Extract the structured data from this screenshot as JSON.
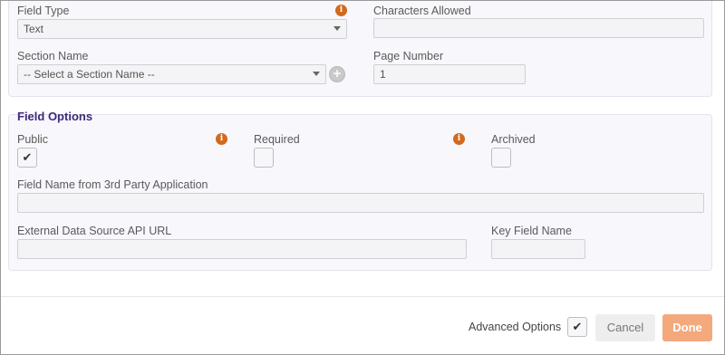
{
  "top_section": {
    "field_type": {
      "label": "Field Type",
      "value": "Text",
      "info_icon": "info-icon"
    },
    "characters_allowed": {
      "label": "Characters Allowed",
      "value": ""
    },
    "section_name": {
      "label": "Section Name",
      "value": "-- Select a Section Name --",
      "add_icon": "plus-icon"
    },
    "page_number": {
      "label": "Page Number",
      "value": "1"
    }
  },
  "field_options": {
    "title": "Field Options",
    "public": {
      "label": "Public",
      "checked": true,
      "check_glyph": "✔",
      "info_icon": "info-icon"
    },
    "required": {
      "label": "Required",
      "checked": false,
      "info_icon": "info-icon"
    },
    "archived": {
      "label": "Archived",
      "checked": false
    },
    "third_party_name": {
      "label": "Field Name from 3rd Party Application",
      "value": ""
    },
    "external_api_url": {
      "label": "External Data Source API URL",
      "value": ""
    },
    "key_field_name": {
      "label": "Key Field Name",
      "value": ""
    }
  },
  "footer": {
    "advanced_options_label": "Advanced Options",
    "advanced_options_checked": true,
    "advanced_check_glyph": "✔",
    "cancel_label": "Cancel",
    "done_label": "Done"
  },
  "colors": {
    "accent_title": "#3d2a7a",
    "info_icon": "#d2691e",
    "done_button": "#f4a97c",
    "panel_bg": "#f8f7fc"
  }
}
